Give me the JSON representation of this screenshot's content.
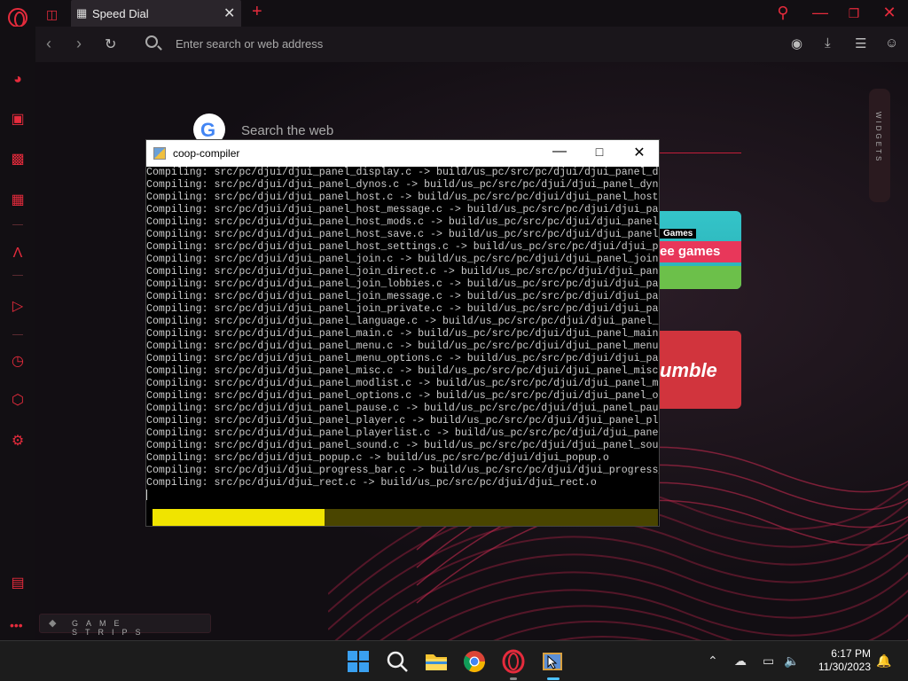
{
  "browser": {
    "tab_title": "Speed Dial",
    "address_placeholder": "Enter search or web address",
    "search_web": "Search the web",
    "widgets_label": "WIDGETS",
    "game_strips_label": "GAME STRIPS",
    "tile1_line1": "Games",
    "tile1_line2": "ee games",
    "tile2_text": "umble"
  },
  "console": {
    "title": "coop-compiler",
    "progress": 0.34,
    "lines": [
      "Compiling: src/pc/djui/djui_panel_display.c -> build/us_pc/src/pc/djui/djui_panel_display.o",
      "Compiling: src/pc/djui/djui_panel_dynos.c -> build/us_pc/src/pc/djui/djui_panel_dynos.o",
      "Compiling: src/pc/djui/djui_panel_host.c -> build/us_pc/src/pc/djui/djui_panel_host.o",
      "Compiling: src/pc/djui/djui_panel_host_message.c -> build/us_pc/src/pc/djui/djui_panel_host_message.o",
      "Compiling: src/pc/djui/djui_panel_host_mods.c -> build/us_pc/src/pc/djui/djui_panel_host_mods.o",
      "Compiling: src/pc/djui/djui_panel_host_save.c -> build/us_pc/src/pc/djui/djui_panel_host_save.o",
      "Compiling: src/pc/djui/djui_panel_host_settings.c -> build/us_pc/src/pc/djui/djui_panel_host_settings.o",
      "Compiling: src/pc/djui/djui_panel_join.c -> build/us_pc/src/pc/djui/djui_panel_join.o",
      "Compiling: src/pc/djui/djui_panel_join_direct.c -> build/us_pc/src/pc/djui/djui_panel_join_direct.o",
      "Compiling: src/pc/djui/djui_panel_join_lobbies.c -> build/us_pc/src/pc/djui/djui_panel_join_lobbies.o",
      "Compiling: src/pc/djui/djui_panel_join_message.c -> build/us_pc/src/pc/djui/djui_panel_join_message.o",
      "Compiling: src/pc/djui/djui_panel_join_private.c -> build/us_pc/src/pc/djui/djui_panel_join_private.o",
      "Compiling: src/pc/djui/djui_panel_language.c -> build/us_pc/src/pc/djui/djui_panel_language.o",
      "Compiling: src/pc/djui/djui_panel_main.c -> build/us_pc/src/pc/djui/djui_panel_main.o",
      "Compiling: src/pc/djui/djui_panel_menu.c -> build/us_pc/src/pc/djui/djui_panel_menu.o",
      "Compiling: src/pc/djui/djui_panel_menu_options.c -> build/us_pc/src/pc/djui/djui_panel_menu_options.o",
      "Compiling: src/pc/djui/djui_panel_misc.c -> build/us_pc/src/pc/djui/djui_panel_misc.o",
      "Compiling: src/pc/djui/djui_panel_modlist.c -> build/us_pc/src/pc/djui/djui_panel_modlist.o",
      "Compiling: src/pc/djui/djui_panel_options.c -> build/us_pc/src/pc/djui/djui_panel_options.o",
      "Compiling: src/pc/djui/djui_panel_pause.c -> build/us_pc/src/pc/djui/djui_panel_pause.o",
      "Compiling: src/pc/djui/djui_panel_player.c -> build/us_pc/src/pc/djui/djui_panel_player.o",
      "Compiling: src/pc/djui/djui_panel_playerlist.c -> build/us_pc/src/pc/djui/djui_panel_playerlist.o",
      "Compiling: src/pc/djui/djui_panel_sound.c -> build/us_pc/src/pc/djui/djui_panel_sound.o",
      "Compiling: src/pc/djui/djui_popup.c -> build/us_pc/src/pc/djui/djui_popup.o",
      "Compiling: src/pc/djui/djui_progress_bar.c -> build/us_pc/src/pc/djui/djui_progress_bar.o",
      "Compiling: src/pc/djui/djui_rect.c -> build/us_pc/src/pc/djui/djui_rect.o"
    ]
  },
  "taskbar": {
    "time": "6:17 PM",
    "date": "11/30/2023"
  },
  "colors": {
    "accent": "#e52b3c",
    "progress_fill": "#f0e400",
    "progress_track": "#4a4500"
  }
}
